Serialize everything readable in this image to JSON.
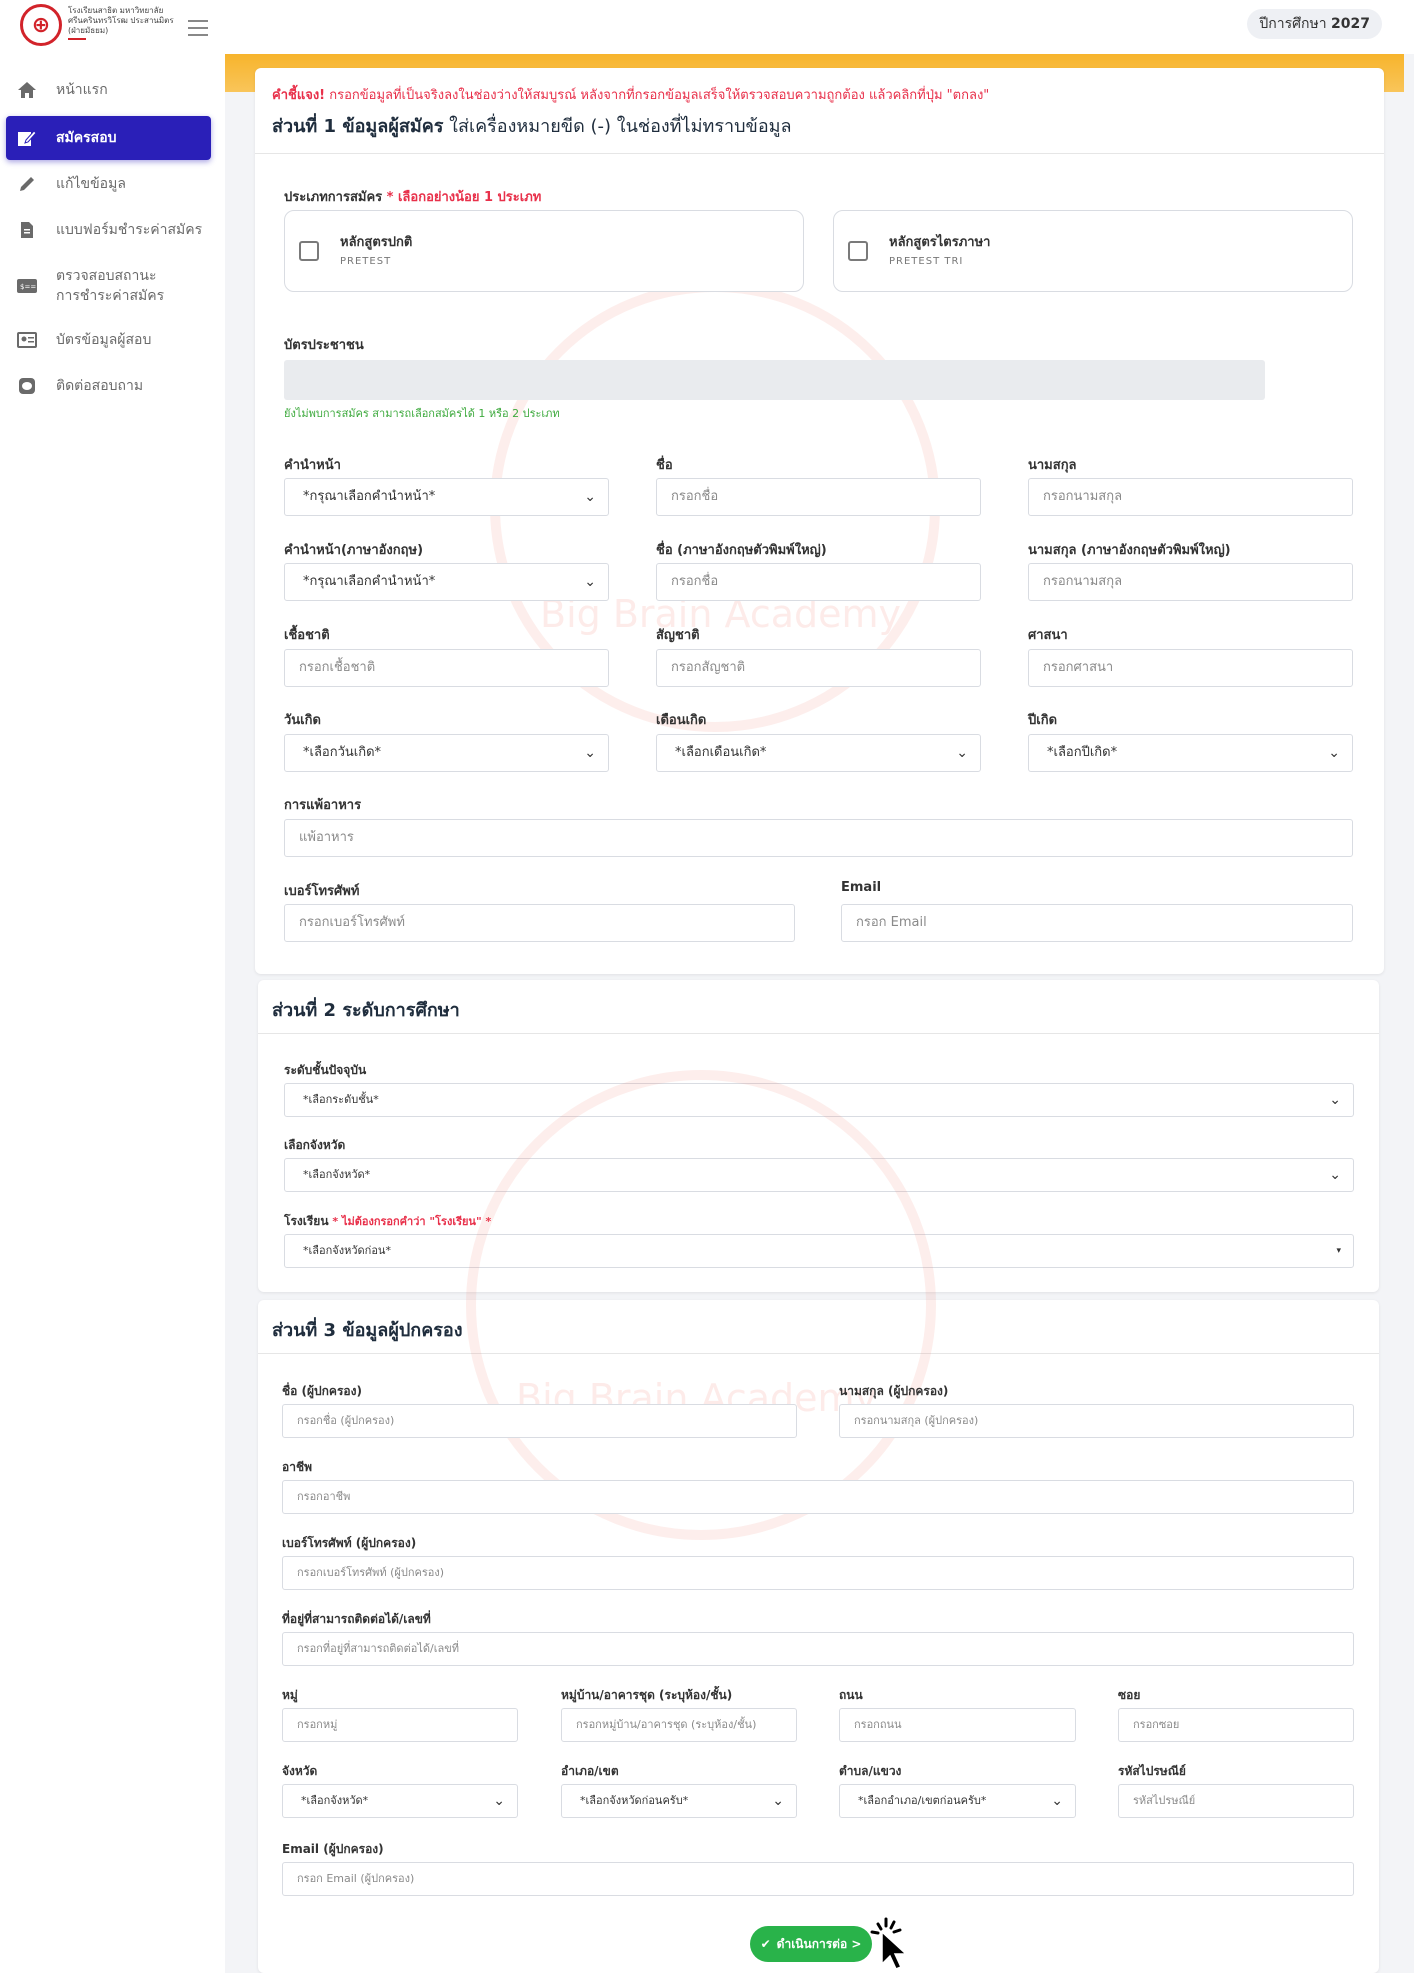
{
  "header": {
    "school_name": "โรงเรียนสาธิต มหาวิทยาลัยศรีนครินทรวิโรฒ ประสานมิตร (ฝ่ายมัธยม)",
    "year_label": "ปีการศึกษา",
    "year_value": "2027"
  },
  "sidebar": {
    "items": [
      {
        "label": "หน้าแรก",
        "icon": "home-icon"
      },
      {
        "label": "สมัครสอบ",
        "icon": "edit-form-icon"
      },
      {
        "label": "แก้ไขข้อมูล",
        "icon": "pencil-icon"
      },
      {
        "label": "แบบฟอร์มชำระค่าสมัคร",
        "icon": "document-icon"
      },
      {
        "label": "ตรวจสอบสถานะ การชำระค่าสมัคร",
        "icon": "payment-card-icon"
      },
      {
        "label": "บัตรข้อมูลผู้สอบ",
        "icon": "id-card-icon"
      },
      {
        "label": "ติดต่อสอบถาม",
        "icon": "line-chat-icon"
      }
    ]
  },
  "instruction": {
    "prefix": "คำชี้แจง!",
    "text": " กรอกข้อมูลที่เป็นจริงลงในช่องว่างให้สมบูรณ์ หลังจากที่กรอกข้อมูลเสร็จให้ตรวจสอบความถูกต้อง แล้วคลิกที่ปุ่ม \"ตกลง\""
  },
  "section1": {
    "title": "ส่วนที่ 1 ข้อมูลผู้สมัคร",
    "subtitle": " ใส่เครื่องหมายขีด (-) ในช่องที่ไม่ทราบข้อมูล",
    "type_label": "ประเภทการสมัคร",
    "type_required": " * เลือกอย่างน้อย 1 ประเภท",
    "types": [
      {
        "name": "หลักสูตรปกติ",
        "code": "PRETEST"
      },
      {
        "name": "หลักสูตรไตรภาษา",
        "code": "PRETEST TRI"
      }
    ],
    "id_card_label": "บัตรประชาชน",
    "id_hint": "ยังไม่พบการสมัคร สามารถเลือกสมัครได้ 1 หรือ 2 ประเภท",
    "prefix_label": "คำนำหน้า",
    "prefix_select": "*กรุณาเลือกคำนำหน้า*",
    "firstname_label": "ชื่อ",
    "firstname_ph": "กรอกชื่อ",
    "lastname_label": "นามสกุล",
    "lastname_ph": "กรอกนามสกุล",
    "prefix_en_label": "คำนำหน้า(ภาษาอังกฤษ)",
    "prefix_en_select": "*กรุณาเลือกคำนำหน้า*",
    "firstname_en_label": "ชื่อ (ภาษาอังกฤษตัวพิมพ์ใหญ่)",
    "firstname_en_ph": "กรอกชื่อ",
    "lastname_en_label": "นามสกุล (ภาษาอังกฤษตัวพิมพ์ใหญ่)",
    "lastname_en_ph": "กรอกนามสกุล",
    "race_label": "เชื้อชาติ",
    "race_ph": "กรอกเชื้อชาติ",
    "nationality_label": "สัญชาติ",
    "nationality_ph": "กรอกสัญชาติ",
    "religion_label": "ศาสนา",
    "religion_ph": "กรอกศาสนา",
    "birth_day_label": "วันเกิด",
    "birth_day_select": "*เลือกวันเกิด*",
    "birth_month_label": "เดือนเกิด",
    "birth_month_select": "*เลือกเดือนเกิด*",
    "birth_year_label": "ปีเกิด",
    "birth_year_select": "*เลือกปีเกิด*",
    "allergy_label": "การแพ้อาหาร",
    "allergy_ph": "แพ้อาหาร",
    "phone_label": "เบอร์โทรศัพท์",
    "phone_ph": "กรอกเบอร์โทรศัพท์",
    "email_label": "Email",
    "email_ph": "กรอก Email"
  },
  "section2": {
    "title": "ส่วนที่ 2 ระดับการศึกษา",
    "level_label": "ระดับชั้นปัจจุบัน",
    "level_select": "*เลือกระดับชั้น*",
    "province_label": "เลือกจังหวัด",
    "province_select": "*เลือกจังหวัด*",
    "school_label": "โรงเรียน",
    "school_note": " * ไม่ต้องกรอกคำว่า \"โรงเรียน\" *",
    "school_select": "*เลือกจังหวัดก่อน*"
  },
  "section3": {
    "title": "ส่วนที่ 3 ข้อมูลผู้ปกครอง",
    "p_first_label": "ชื่อ (ผู้ปกครอง)",
    "p_first_ph": "กรอกชื่อ (ผู้ปกครอง)",
    "p_last_label": "นามสกุล (ผู้ปกครอง)",
    "p_last_ph": "กรอกนามสกุล (ผู้ปกครอง)",
    "job_label": "อาชีพ",
    "job_ph": "กรอกอาชีพ",
    "p_phone_label": "เบอร์โทรศัพท์ (ผู้ปกครอง)",
    "p_phone_ph": "กรอกเบอร์โทรศัพท์ (ผู้ปกครอง)",
    "address_label": "ที่อยู่ที่สามารถติดต่อได้/เลขที่",
    "address_ph": "กรอกที่อยู่ที่สามารถติดต่อได้/เลขที่",
    "moo_label": "หมู่",
    "moo_ph": "กรอกหมู่",
    "village_label": "หมู่บ้าน/อาคารชุด (ระบุห้อง/ชั้น)",
    "village_ph": "กรอกหมู่บ้าน/อาคารชุด (ระบุห้อง/ชั้น)",
    "road_label": "ถนน",
    "road_ph": "กรอกถนน",
    "soi_label": "ซอย",
    "soi_ph": "กรอกซอย",
    "prov_label": "จังหวัด",
    "prov_select": "*เลือกจังหวัด*",
    "district_label": "อำเภอ/เขต",
    "district_select": "*เลือกจังหวัดก่อนครับ*",
    "subdistrict_label": "ตำบล/แขวง",
    "subdistrict_select": "*เลือกอำเภอ/เขตก่อนครับ*",
    "zip_label": "รหัสไปรษณีย์",
    "zip_ph": "รหัสไปรษณีย์",
    "p_email_label": "Email (ผู้ปกครอง)",
    "p_email_ph": "กรอก Email (ผู้ปกครอง)"
  },
  "submit_label": "ดำเนินการต่อ >",
  "watermark_text": "Big Brain Academy",
  "colors": {
    "accent": "#2a1fb8",
    "warning": "#f7b42c",
    "error": "#e8304a",
    "success": "#29b34a"
  }
}
